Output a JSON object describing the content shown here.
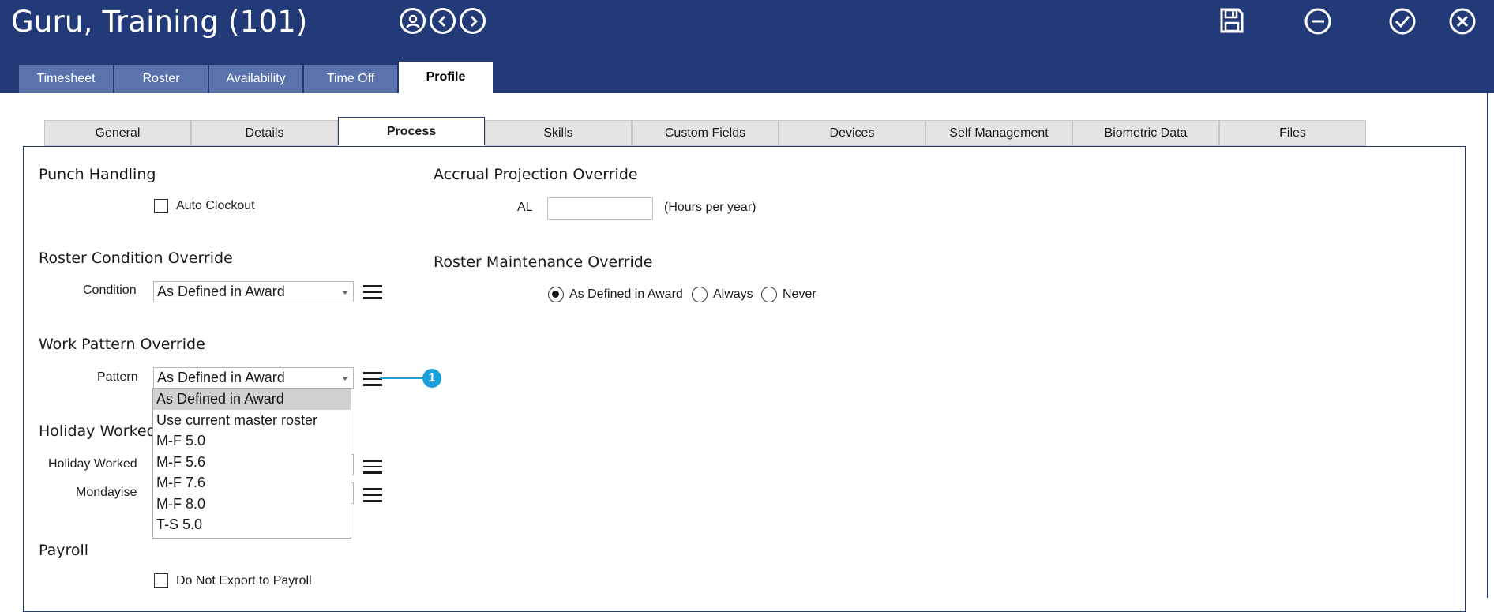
{
  "window": {
    "title": "Guru, Training (101)"
  },
  "nav_icons": [
    "user-circle-icon",
    "chevron-left-icon",
    "chevron-right-icon"
  ],
  "action_icons": [
    "save-icon",
    "minus-circle-icon",
    "check-circle-icon",
    "close-circle-icon"
  ],
  "main_tabs": [
    {
      "label": "Timesheet"
    },
    {
      "label": "Roster"
    },
    {
      "label": "Availability"
    },
    {
      "label": "Time Off"
    },
    {
      "label": "Profile"
    }
  ],
  "sub_tabs": [
    {
      "label": "General"
    },
    {
      "label": "Details"
    },
    {
      "label": "Process"
    },
    {
      "label": "Skills"
    },
    {
      "label": "Custom Fields"
    },
    {
      "label": "Devices"
    },
    {
      "label": "Self Management"
    },
    {
      "label": "Biometric Data"
    },
    {
      "label": "Files"
    }
  ],
  "punch_handling": {
    "title": "Punch Handling",
    "auto_clockout_label": "Auto Clockout"
  },
  "accrual": {
    "title": "Accrual Projection Override",
    "al_label": "AL",
    "al_value": "",
    "unit_label": "(Hours per year)"
  },
  "roster_condition": {
    "title": "Roster Condition Override",
    "condition_label": "Condition",
    "condition_value": "As Defined in Award"
  },
  "roster_maintenance": {
    "title": "Roster Maintenance Override",
    "options": [
      "As Defined in Award",
      "Always",
      "Never"
    ],
    "selected": "As Defined in Award"
  },
  "work_pattern": {
    "title": "Work Pattern Override",
    "pattern_label": "Pattern",
    "pattern_value": "As Defined in Award",
    "options": [
      "As Defined in Award",
      "Use current master roster",
      "M-F 5.0",
      "M-F 5.6",
      "M-F 7.6",
      "M-F 8.0",
      "T-S 5.0"
    ]
  },
  "holiday_worked": {
    "title": "Holiday Worked C",
    "holiday_worked_label": "Holiday Worked",
    "mondayise_label": "Mondayise"
  },
  "payroll": {
    "title": "Payroll",
    "do_not_export_label": "Do Not Export to Payroll"
  },
  "callout": {
    "number": "1",
    "color": "#1a9fd8"
  },
  "colors": {
    "header": "#233a78",
    "tab": "#5a73ad",
    "subtab": "#e4e4e4"
  }
}
